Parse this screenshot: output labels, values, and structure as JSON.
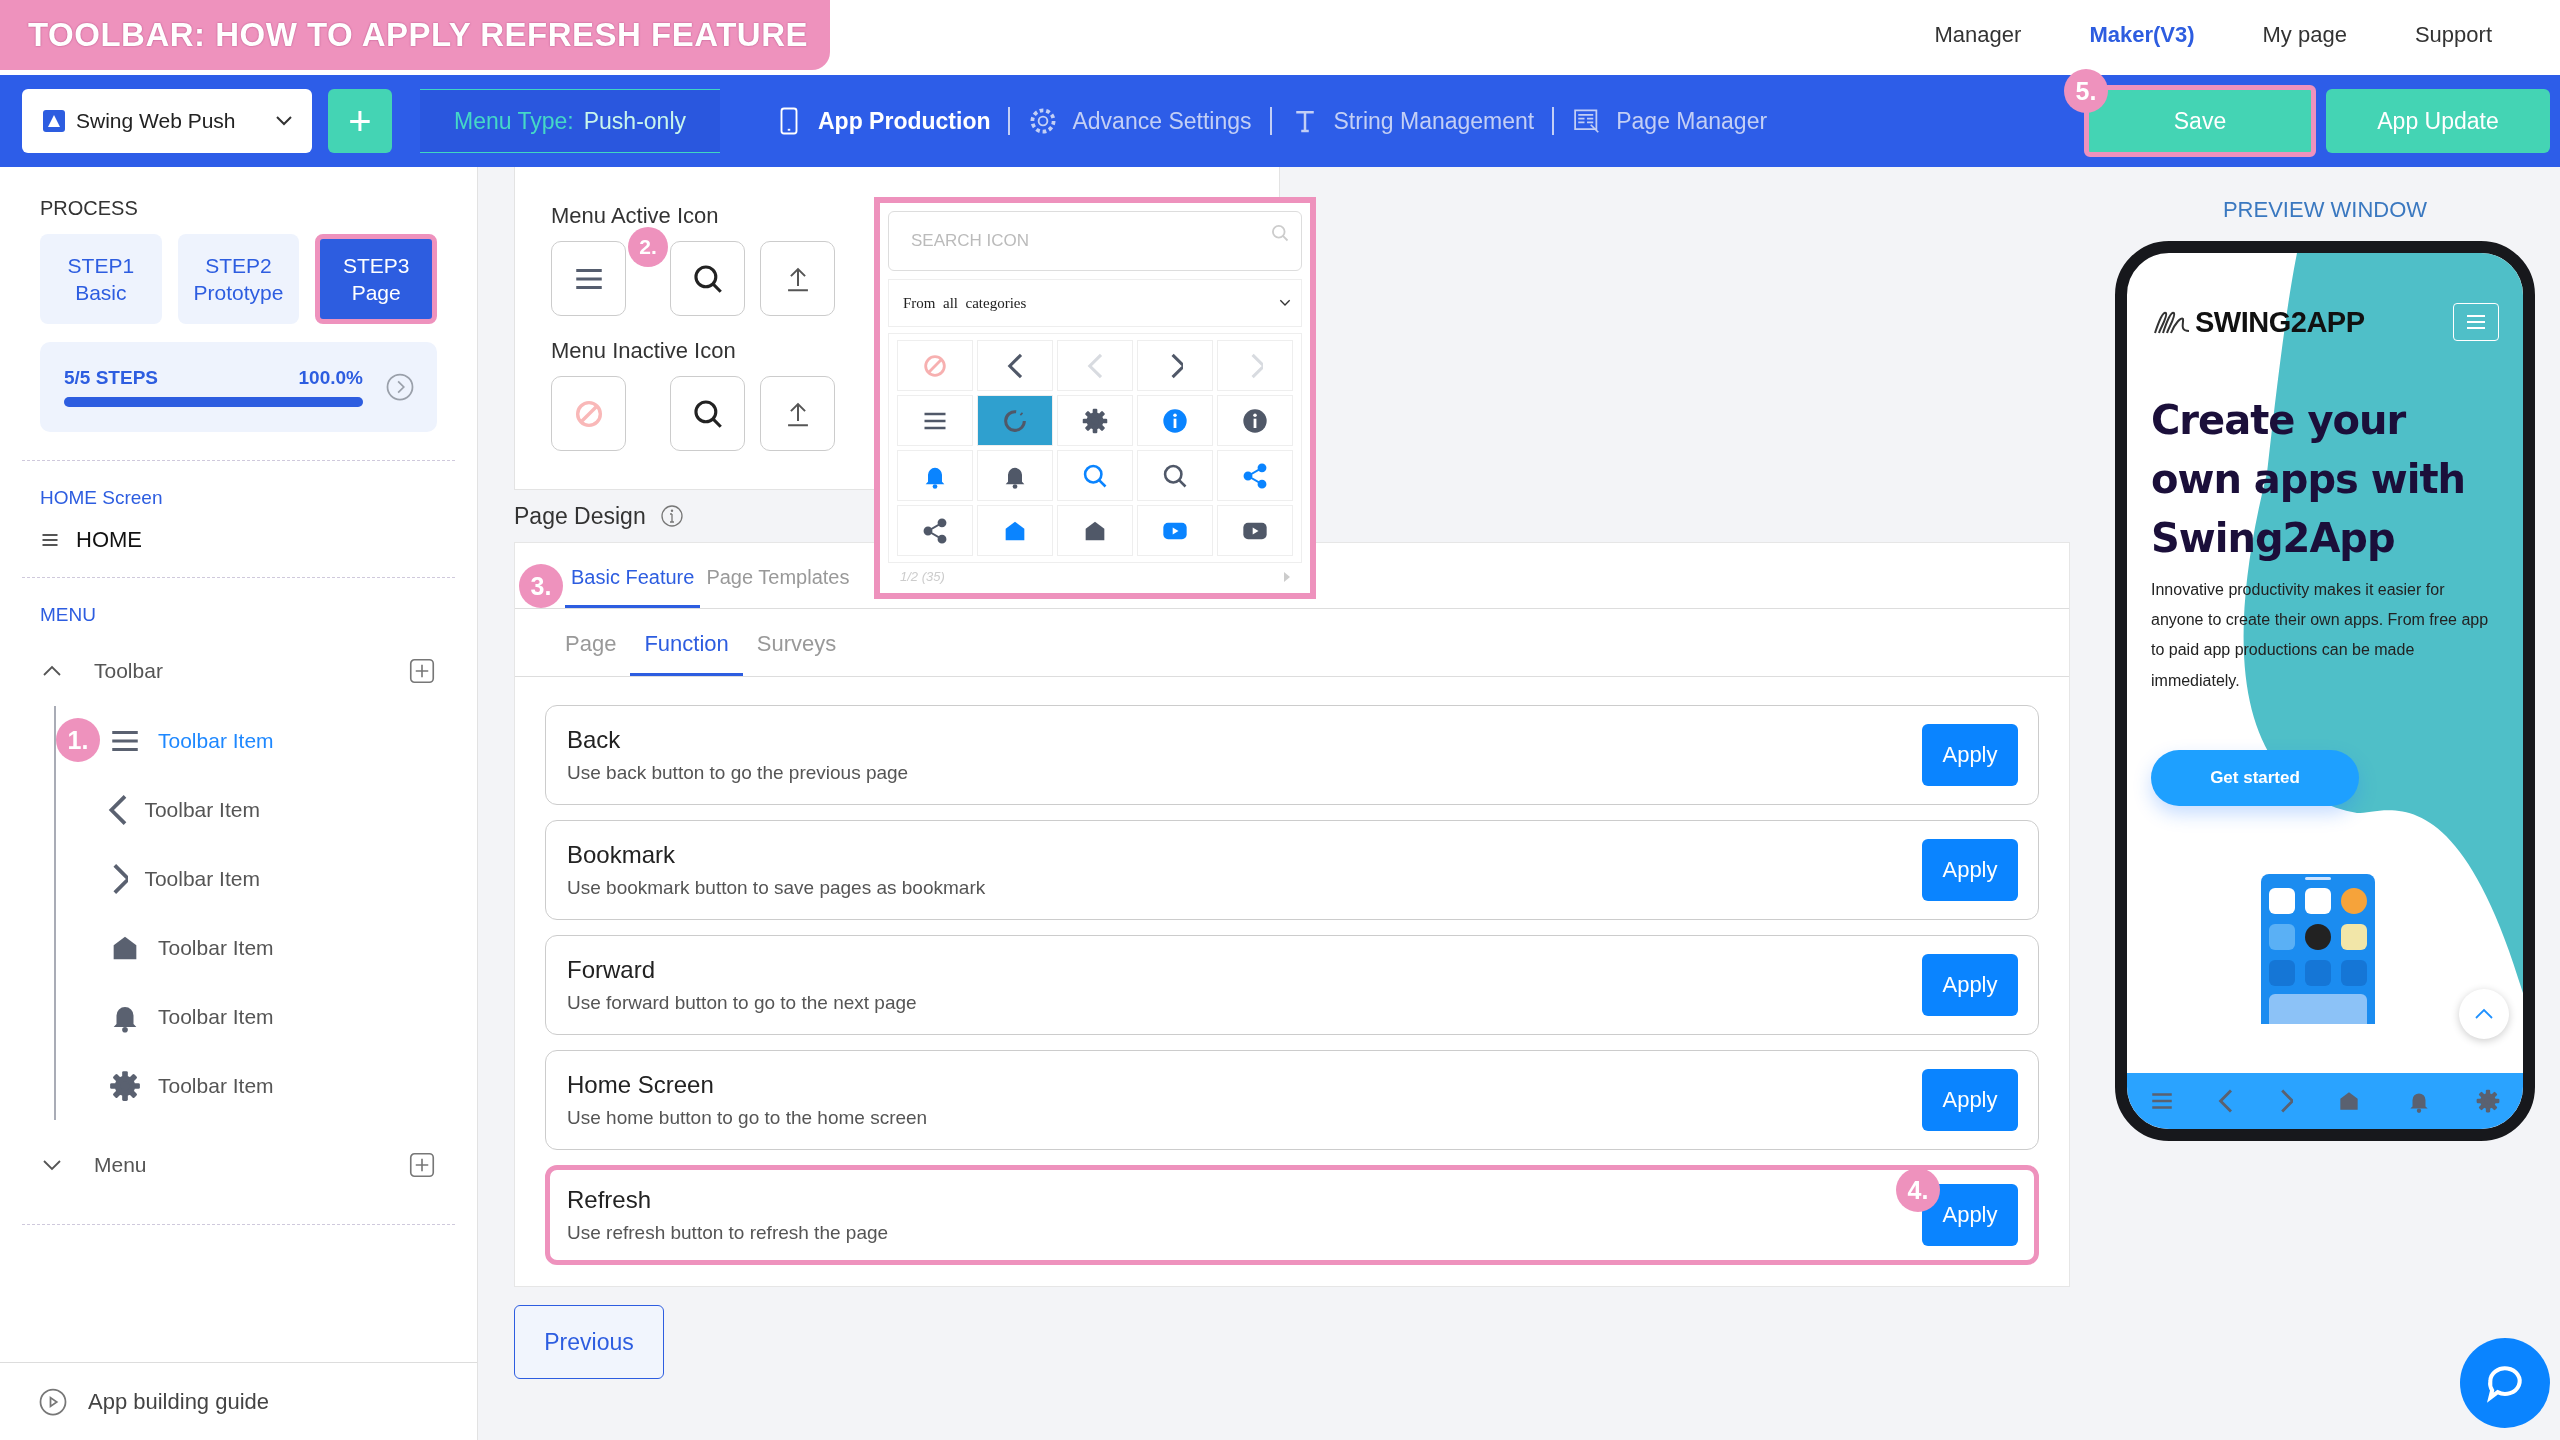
{
  "banner": {
    "title": "TOOLBAR: HOW TO APPLY REFRESH FEATURE"
  },
  "top_nav": [
    {
      "label": "Manager",
      "selected": false
    },
    {
      "label": "Maker(V3)",
      "selected": true
    },
    {
      "label": "My page",
      "selected": false
    },
    {
      "label": "Support",
      "selected": false
    }
  ],
  "toolbar": {
    "app_selector": {
      "value": "Swing Web Push"
    },
    "add_button": "+",
    "menu_type": {
      "label": "Menu Type:",
      "value": "Push-only"
    },
    "tabs": [
      {
        "label": "App Production",
        "selected": true
      },
      {
        "label": "Advance Settings",
        "selected": false
      },
      {
        "label": "String Management",
        "selected": false
      },
      {
        "label": "Page Manager",
        "selected": false
      }
    ],
    "buttons": [
      {
        "label": "Save",
        "highlighted": true,
        "badge": "5."
      },
      {
        "label": "App Update",
        "highlighted": false
      }
    ]
  },
  "sidebar": {
    "process_title": "PROCESS",
    "steps": [
      {
        "label": "STEP1",
        "sublabel": "Basic",
        "selected": false,
        "highlighted": false
      },
      {
        "label": "STEP2",
        "sublabel": "Prototype",
        "selected": false,
        "highlighted": false
      },
      {
        "label": "STEP3",
        "sublabel": "Page",
        "selected": true,
        "highlighted": true
      }
    ],
    "progress": {
      "label": "5/5 STEPS",
      "percent": "100.0%",
      "level": 1
    },
    "home_section": {
      "title": "HOME Screen",
      "item": "HOME"
    },
    "menu_section": {
      "title": "MENU",
      "tree": [
        {
          "label": "Toolbar",
          "expanded": true,
          "children": [
            {
              "label": "Toolbar Item",
              "selected": true,
              "badge": "1."
            },
            {
              "label": "Toolbar Item",
              "selected": false
            },
            {
              "label": "Toolbar Item",
              "selected": false
            },
            {
              "label": "Toolbar Item",
              "selected": false
            },
            {
              "label": "Toolbar Item",
              "selected": false
            },
            {
              "label": "Toolbar Item",
              "selected": false
            }
          ]
        },
        {
          "label": "Menu",
          "expanded": false
        }
      ]
    },
    "guide_link": "App building guide"
  },
  "icon_settings": {
    "active_label": "Menu Active Icon",
    "active_badge": "2.",
    "inactive_label": "Menu Inactive Icon"
  },
  "icon_picker": {
    "highlighted": true,
    "search_placeholder": "SEARCH ICON",
    "category": "From  all  categories",
    "pagination": "1/2 (35)",
    "icons": [
      {
        "selected": false,
        "color": "#f7b0b0"
      },
      {
        "selected": false,
        "color": "#505868"
      },
      {
        "selected": false,
        "color": "#d8dbe0"
      },
      {
        "selected": false,
        "color": "#505868"
      },
      {
        "selected": false,
        "color": "#d8dbe0"
      },
      {
        "selected": false,
        "color": "#505868"
      },
      {
        "selected": true,
        "color": "#505868"
      },
      {
        "selected": false,
        "color": "#505868"
      },
      {
        "selected": false,
        "color": "#0a84ff"
      },
      {
        "selected": false,
        "color": "#505868"
      },
      {
        "selected": false,
        "color": "#0a84ff"
      },
      {
        "selected": false,
        "color": "#505868"
      },
      {
        "selected": false,
        "color": "#0a84ff"
      },
      {
        "selected": false,
        "color": "#505868"
      },
      {
        "selected": false,
        "color": "#0a84ff"
      },
      {
        "selected": false,
        "color": "#505868"
      },
      {
        "selected": false,
        "color": "#0a84ff"
      },
      {
        "selected": false,
        "color": "#505868"
      },
      {
        "selected": false,
        "color": "#0a84ff"
      },
      {
        "selected": false,
        "color": "#505868"
      }
    ]
  },
  "page_design": {
    "title": "Page Design",
    "tabs": [
      {
        "label": "Basic Feature",
        "selected": true,
        "badge": "3."
      },
      {
        "label": "Page Templates",
        "selected": false
      }
    ],
    "subtabs": [
      {
        "label": "Page",
        "selected": false
      },
      {
        "label": "Function",
        "selected": true
      },
      {
        "label": "Surveys",
        "selected": false
      }
    ],
    "functions": [
      {
        "title": "Back",
        "description": "Use back button to go the previous page",
        "button": "Apply",
        "highlighted": false
      },
      {
        "title": "Bookmark",
        "description": "Use bookmark button to save pages as bookmark",
        "button": "Apply",
        "highlighted": false
      },
      {
        "title": "Forward",
        "description": "Use forward button to go to the next page",
        "button": "Apply",
        "highlighted": false
      },
      {
        "title": "Home Screen",
        "description": "Use home button to go to the home screen",
        "button": "Apply",
        "highlighted": false
      },
      {
        "title": "Refresh",
        "description": "Use refresh button to refresh the page",
        "button": "Apply",
        "highlighted": true,
        "badge": "4."
      }
    ]
  },
  "previous_button": "Previous",
  "preview": {
    "title": "PREVIEW WINDOW",
    "brand": "SWING2APP",
    "headline": "Create your own apps with Swing2App",
    "body": "Innovative productivity makes it easier for anyone to create their own apps. From free app to paid app productions can be made immediately.",
    "cta": "Get started"
  }
}
